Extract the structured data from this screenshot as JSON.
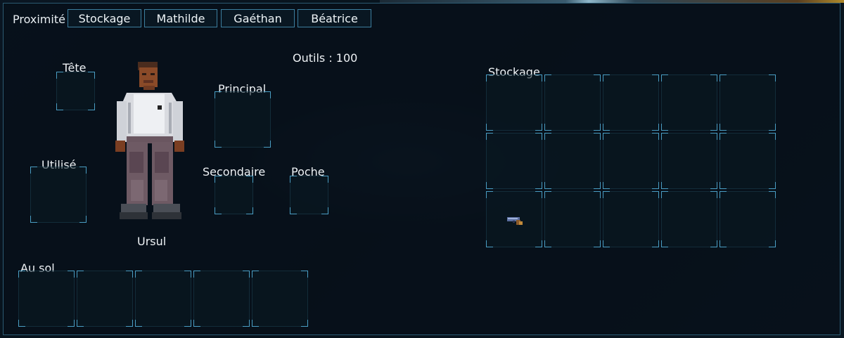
{
  "tabs": {
    "label": "Proximité",
    "items": [
      "Stockage",
      "Mathilde",
      "Gaéthan",
      "Béatrice"
    ]
  },
  "tools": {
    "text": "Outils : 100"
  },
  "character": {
    "name": "Ursul"
  },
  "equipment": {
    "head": "Tête",
    "used": "Utilisé",
    "primary": "Principal",
    "secondary": "Secondaire",
    "pocket": "Poche"
  },
  "ground": {
    "label": "Au sol",
    "slot_count": 5
  },
  "storage": {
    "label": "Stockage",
    "rows": 3,
    "cols": 5,
    "items": [
      {
        "row": 2,
        "col": 0,
        "icon": "pistol-icon"
      }
    ]
  },
  "colors": {
    "accent": "#4a9ec4",
    "tab_border": "#3c7e9e",
    "panel_border": "#2b5a72"
  }
}
